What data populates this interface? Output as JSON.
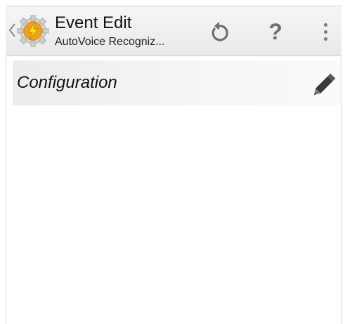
{
  "action_bar": {
    "title": "Event Edit",
    "subtitle": "AutoVoice Recogniz...",
    "help_label": "?",
    "icons": {
      "back": "chevron-left-icon",
      "app": "tasker-app-icon",
      "undo": "undo-icon",
      "overflow": "overflow-menu-icon"
    }
  },
  "content": {
    "configuration_label": "Configuration",
    "edit_icon": "pencil-icon"
  },
  "colors": {
    "action_bar_bg": "#eeeeee",
    "row_bg": "#f0f0f0",
    "icon_gray": "#6e6e6e",
    "app_icon_orange": "#f0a020",
    "app_icon_bolt": "#f5e020"
  }
}
